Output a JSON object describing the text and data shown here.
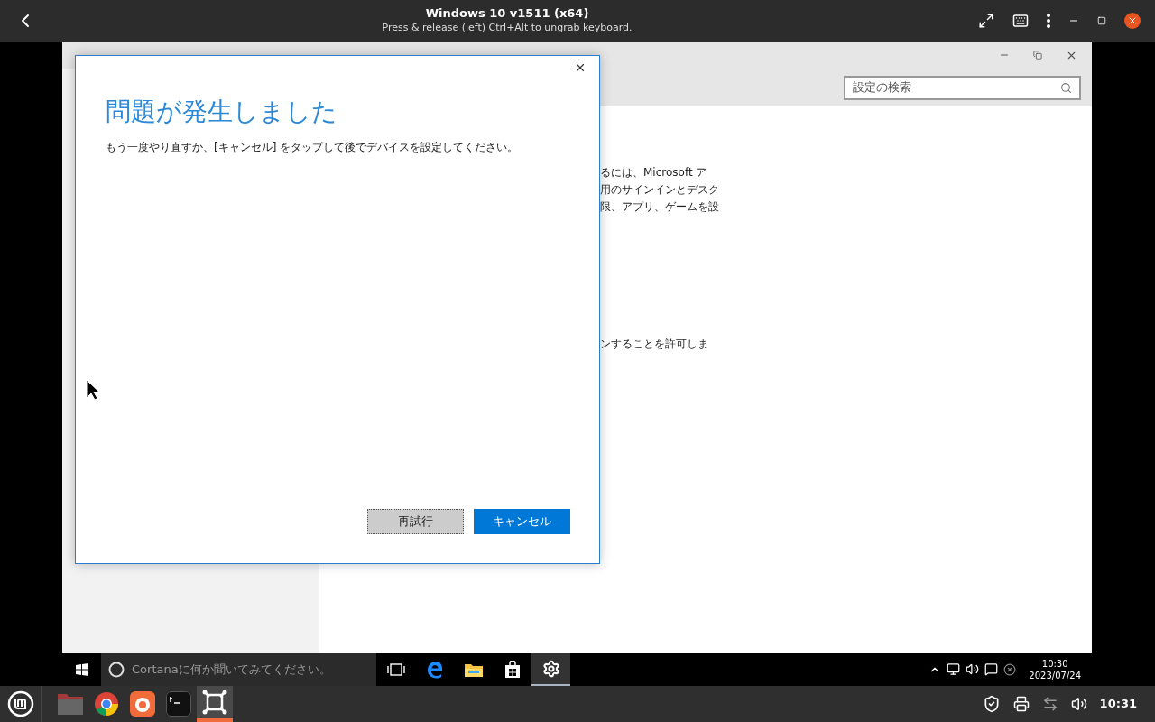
{
  "vm_titlebar": {
    "title": "Windows 10 v1511 (x64)",
    "subtitle": "Press & release (left) Ctrl+Alt to ungrab keyboard."
  },
  "settings_window": {
    "search": {
      "placeholder": "設定の検索"
    },
    "content_lines": [
      "るには、Microsoft ア",
      "用のサインインとデスク",
      "限、アプリ、ゲームを設"
    ],
    "content_lines_2": [
      "ンすることを許可しま"
    ]
  },
  "dialog": {
    "title": "問題が発生しました",
    "message": "もう一度やり直すか、[キャンセル] をタップして後でデバイスを設定してください。",
    "buttons": [
      {
        "label": "再試行",
        "kind": "secondary"
      },
      {
        "label": "キャンセル",
        "kind": "primary"
      }
    ]
  },
  "windows_taskbar": {
    "search_placeholder": "Cortanaに何か聞いてみてください。",
    "apps": [
      {
        "kind": "task-view",
        "selected": false
      },
      {
        "kind": "edge",
        "selected": false
      },
      {
        "kind": "explorer",
        "selected": false
      },
      {
        "kind": "store",
        "selected": false
      },
      {
        "kind": "settings",
        "selected": true
      }
    ],
    "clock": {
      "time": "10:30",
      "date": "2023/07/24"
    }
  },
  "linux_panel": {
    "launchers": [
      {
        "kind": "files",
        "selected": false
      },
      {
        "kind": "chrome",
        "selected": false
      },
      {
        "kind": "firefox",
        "selected": false
      },
      {
        "kind": "terminal",
        "selected": false
      },
      {
        "kind": "vm",
        "selected": true
      }
    ],
    "clock": "10:31"
  }
}
